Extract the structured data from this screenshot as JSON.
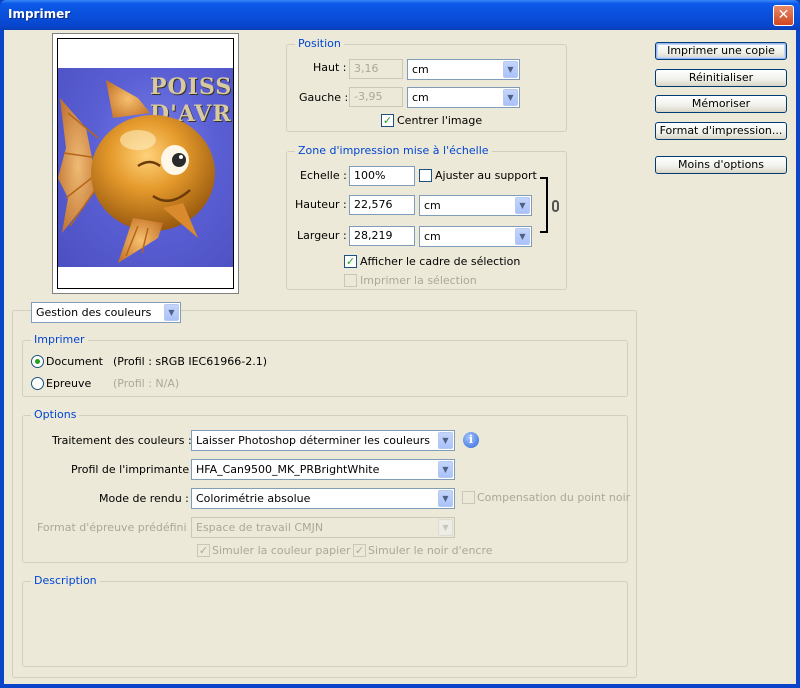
{
  "window": {
    "title": "Imprimer"
  },
  "buttons": {
    "print_one": "Imprimer une copie",
    "reset": "Réinitialiser",
    "memorize": "Mémoriser",
    "page_setup": "Format d'impression...",
    "fewer_options": "Moins d'options"
  },
  "preview": {
    "poster_line1": "POISS",
    "poster_line2": "D'AVR"
  },
  "position": {
    "legend": "Position",
    "top_label": "Haut :",
    "top_value": "3,16",
    "top_unit": "cm",
    "left_label": "Gauche :",
    "left_value": "-3,95",
    "left_unit": "cm",
    "center_label": "Centrer l'image",
    "center_checked": true
  },
  "scaled": {
    "legend": "Zone d'impression mise à l'échelle",
    "scale_label": "Echelle :",
    "scale_value": "100%",
    "fit_label": "Ajuster au support",
    "height_label": "Hauteur :",
    "height_value": "22,576",
    "height_unit": "cm",
    "width_label": "Largeur :",
    "width_value": "28,219",
    "width_unit": "cm",
    "bbox_label": "Afficher le cadre de sélection",
    "print_selection_label": "Imprimer la sélection"
  },
  "color_mgmt": {
    "dropdown": "Gestion des couleurs",
    "print_legend": "Imprimer",
    "document_label": "Document",
    "document_profile": "(Profil : sRGB IEC61966-2.1)",
    "proof_label": "Epreuve",
    "proof_profile": "(Profil : N/A)"
  },
  "options": {
    "legend": "Options",
    "color_handling_label": "Traitement des couleurs :",
    "color_handling_value": "Laisser Photoshop déterminer les couleurs",
    "printer_profile_label": "Profil de l'imprimante :",
    "printer_profile_value": "HFA_Can9500_MK_PRBrightWhite",
    "rendering_label": "Mode de rendu :",
    "rendering_value": "Colorimétrie absolue",
    "bpc_label": "Compensation du point noir",
    "proof_setup_label": "Format d'épreuve prédéfini :",
    "proof_setup_value": "Espace de travail CMJN",
    "paper_color_label": "Simuler la couleur papier",
    "black_ink_label": "Simuler le noir d'encre"
  },
  "description": {
    "legend": "Description"
  }
}
